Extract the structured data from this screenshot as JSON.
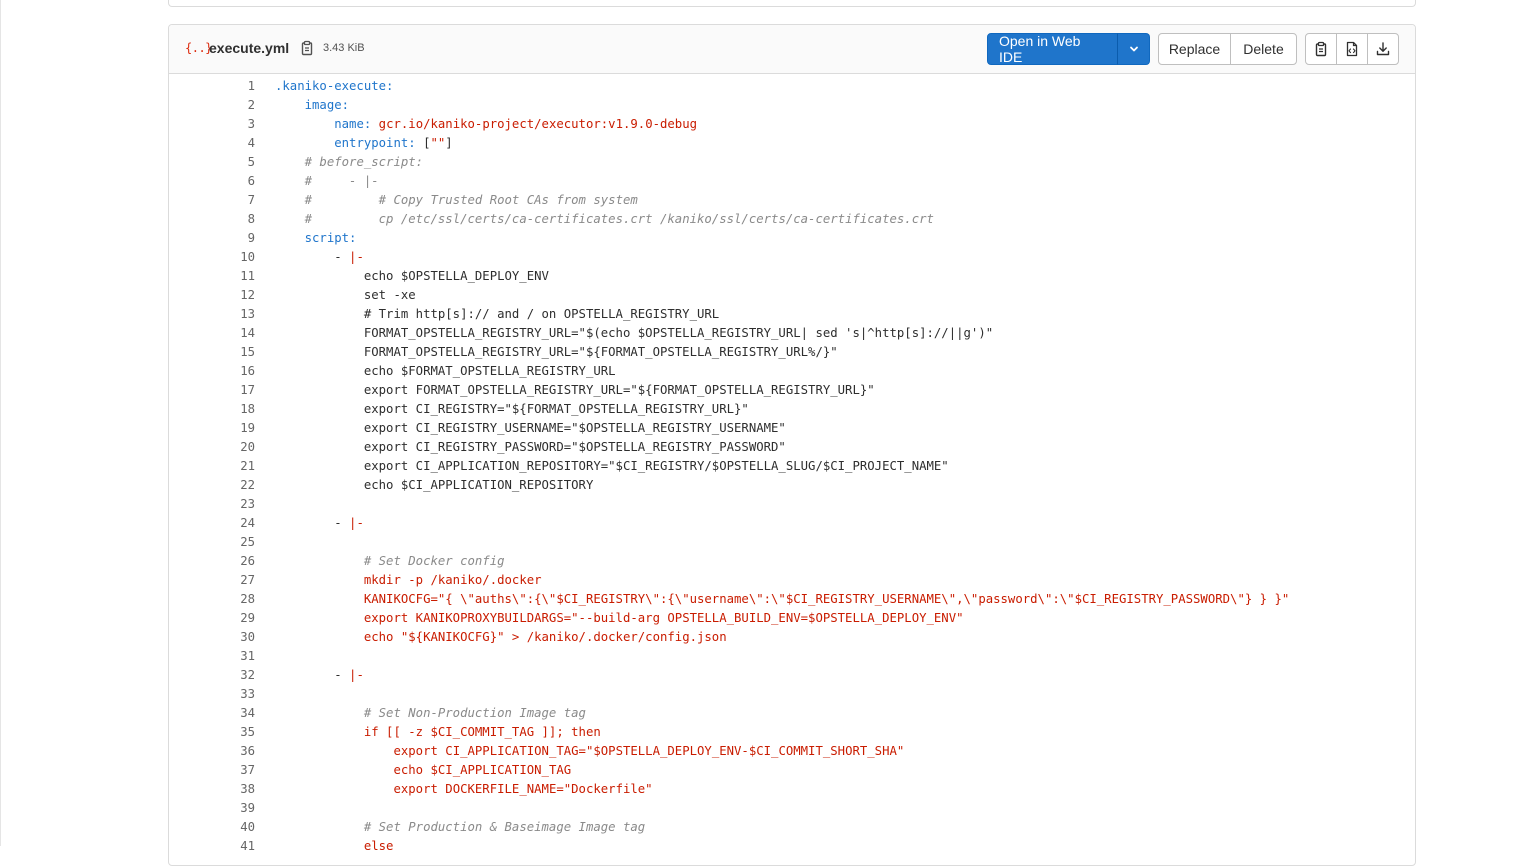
{
  "file": {
    "icon": "yaml-file-icon",
    "icon_glyph": "{..}",
    "name": "execute.yml",
    "size": "3.43 KiB"
  },
  "actions": {
    "open_web_ide": "Open in Web IDE",
    "replace": "Replace",
    "delete": "Delete"
  },
  "icons": {
    "copy_path": "copy-to-clipboard-icon",
    "dropdown": "chevron-down-icon",
    "copy_contents": "copy-to-clipboard-icon",
    "raw": "file-code-icon",
    "download": "download-icon"
  },
  "colors": {
    "primary": "#1f75cb",
    "key": "#1f75cb",
    "string": "#c91c00",
    "comment": "#8a8a8a"
  },
  "code_lines": [
    [
      {
        "t": "k",
        "v": ".kaniko-execute:"
      }
    ],
    [
      {
        "t": "p",
        "v": "    "
      },
      {
        "t": "k",
        "v": "image:"
      }
    ],
    [
      {
        "t": "p",
        "v": "        "
      },
      {
        "t": "k",
        "v": "name:"
      },
      {
        "t": "p",
        "v": " "
      },
      {
        "t": "s",
        "v": "gcr.io/kaniko-project/executor:v1.9.0-debug"
      }
    ],
    [
      {
        "t": "p",
        "v": "        "
      },
      {
        "t": "k",
        "v": "entrypoint:"
      },
      {
        "t": "p",
        "v": " ["
      },
      {
        "t": "s",
        "v": "\"\""
      },
      {
        "t": "p",
        "v": "]"
      }
    ],
    [
      {
        "t": "p",
        "v": "    "
      },
      {
        "t": "c",
        "v": "# before_script:"
      }
    ],
    [
      {
        "t": "p",
        "v": "    "
      },
      {
        "t": "c",
        "v": "#     - |-"
      }
    ],
    [
      {
        "t": "p",
        "v": "    "
      },
      {
        "t": "c",
        "v": "#         # Copy Trusted Root CAs from system"
      }
    ],
    [
      {
        "t": "p",
        "v": "    "
      },
      {
        "t": "c",
        "v": "#         cp /etc/ssl/certs/ca-certificates.crt /kaniko/ssl/certs/ca-certificates.crt"
      }
    ],
    [
      {
        "t": "p",
        "v": "    "
      },
      {
        "t": "k",
        "v": "script:"
      }
    ],
    [
      {
        "t": "p",
        "v": "        - "
      },
      {
        "t": "s",
        "v": "|-"
      }
    ],
    [
      {
        "t": "p",
        "v": "            echo $OPSTELLA_DEPLOY_ENV"
      }
    ],
    [
      {
        "t": "p",
        "v": "            set -xe"
      }
    ],
    [
      {
        "t": "p",
        "v": "            # Trim http[s]:// and / on OPSTELLA_REGISTRY_URL"
      }
    ],
    [
      {
        "t": "p",
        "v": "            FORMAT_OPSTELLA_REGISTRY_URL=\"$(echo $OPSTELLA_REGISTRY_URL| sed 's|^http[s]://||g')\""
      }
    ],
    [
      {
        "t": "p",
        "v": "            FORMAT_OPSTELLA_REGISTRY_URL=\"${FORMAT_OPSTELLA_REGISTRY_URL%/}\""
      }
    ],
    [
      {
        "t": "p",
        "v": "            echo $FORMAT_OPSTELLA_REGISTRY_URL"
      }
    ],
    [
      {
        "t": "p",
        "v": "            export FORMAT_OPSTELLA_REGISTRY_URL=\"${FORMAT_OPSTELLA_REGISTRY_URL}\""
      }
    ],
    [
      {
        "t": "p",
        "v": "            export CI_REGISTRY=\"${FORMAT_OPSTELLA_REGISTRY_URL}\""
      }
    ],
    [
      {
        "t": "p",
        "v": "            export CI_REGISTRY_USERNAME=\"$OPSTELLA_REGISTRY_USERNAME\""
      }
    ],
    [
      {
        "t": "p",
        "v": "            export CI_REGISTRY_PASSWORD=\"$OPSTELLA_REGISTRY_PASSWORD\""
      }
    ],
    [
      {
        "t": "p",
        "v": "            export CI_APPLICATION_REPOSITORY=\"$CI_REGISTRY/$OPSTELLA_SLUG/$CI_PROJECT_NAME\""
      }
    ],
    [
      {
        "t": "p",
        "v": "            echo $CI_APPLICATION_REPOSITORY"
      }
    ],
    [],
    [
      {
        "t": "p",
        "v": "        - "
      },
      {
        "t": "s",
        "v": "|-"
      }
    ],
    [],
    [
      {
        "t": "p",
        "v": "            "
      },
      {
        "t": "c",
        "v": "# Set Docker config"
      }
    ],
    [
      {
        "t": "p",
        "v": "            "
      },
      {
        "t": "s",
        "v": "mkdir -p /kaniko/.docker"
      }
    ],
    [
      {
        "t": "p",
        "v": "            "
      },
      {
        "t": "s",
        "v": "KANIKOCFG=\"{ \\\"auths\\\":{\\\"$CI_REGISTRY\\\":{\\\"username\\\":\\\"$CI_REGISTRY_USERNAME\\\",\\\"password\\\":\\\"$CI_REGISTRY_PASSWORD\\\"} } }\""
      }
    ],
    [
      {
        "t": "p",
        "v": "            "
      },
      {
        "t": "s",
        "v": "export KANIKOPROXYBUILDARGS=\"--build-arg OPSTELLA_BUILD_ENV=$OPSTELLA_DEPLOY_ENV\""
      }
    ],
    [
      {
        "t": "p",
        "v": "            "
      },
      {
        "t": "s",
        "v": "echo \"${KANIKOCFG}\" > /kaniko/.docker/config.json"
      }
    ],
    [],
    [
      {
        "t": "p",
        "v": "        - "
      },
      {
        "t": "s",
        "v": "|-"
      }
    ],
    [],
    [
      {
        "t": "p",
        "v": "            "
      },
      {
        "t": "c",
        "v": "# Set Non-Production Image tag"
      }
    ],
    [
      {
        "t": "p",
        "v": "            "
      },
      {
        "t": "s",
        "v": "if [[ -z $CI_COMMIT_TAG ]]; then"
      }
    ],
    [
      {
        "t": "p",
        "v": "                "
      },
      {
        "t": "s",
        "v": "export CI_APPLICATION_TAG=\"$OPSTELLA_DEPLOY_ENV-$CI_COMMIT_SHORT_SHA\""
      }
    ],
    [
      {
        "t": "p",
        "v": "                "
      },
      {
        "t": "s",
        "v": "echo $CI_APPLICATION_TAG"
      }
    ],
    [
      {
        "t": "p",
        "v": "                "
      },
      {
        "t": "s",
        "v": "export DOCKERFILE_NAME=\"Dockerfile\""
      }
    ],
    [],
    [
      {
        "t": "p",
        "v": "            "
      },
      {
        "t": "c",
        "v": "# Set Production & Baseimage Image tag"
      }
    ],
    [
      {
        "t": "p",
        "v": "            "
      },
      {
        "t": "s",
        "v": "else"
      }
    ]
  ]
}
